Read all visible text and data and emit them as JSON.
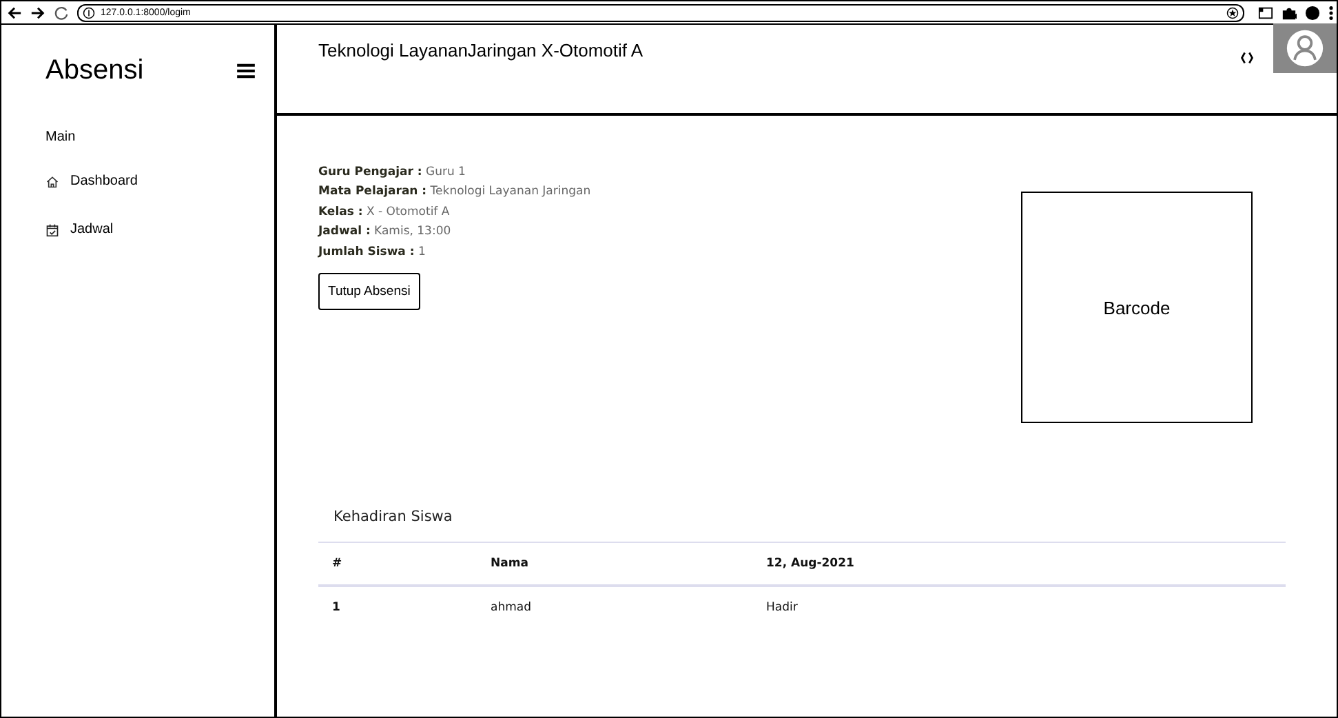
{
  "browser": {
    "url": "127.0.0.1:8000/logim"
  },
  "sidebar": {
    "title": "Absensi",
    "section": "Main",
    "items": [
      {
        "label": "Dashboard"
      },
      {
        "label": "Jadwal"
      }
    ]
  },
  "header": {
    "title": "Teknologi LayananJaringan X-Otomotif A"
  },
  "details": [
    {
      "label": "Guru Pengajar :",
      "value": "Guru 1"
    },
    {
      "label": "Mata Pelajaran :",
      "value": "Teknologi Layanan Jaringan"
    },
    {
      "label": "Kelas :",
      "value": "X - Otomotif A"
    },
    {
      "label": "Jadwal :",
      "value": "Kamis, 13:00"
    },
    {
      "label": "Jumlah Siswa :",
      "value": "1"
    }
  ],
  "close_button": "Tutup Absensi",
  "barcode": "Barcode",
  "attendance": {
    "title": "Kehadiran Siswa",
    "columns": [
      "#",
      "Nama",
      "12, Aug-2021"
    ],
    "rows": [
      [
        "1",
        "ahmad",
        "Hadir"
      ]
    ]
  }
}
